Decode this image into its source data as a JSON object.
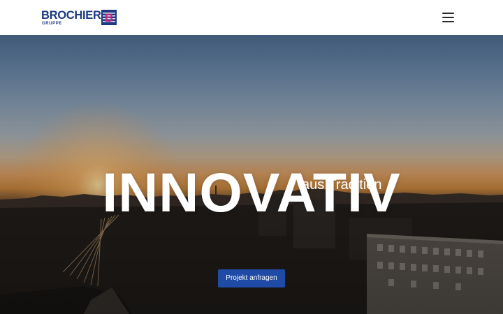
{
  "header": {
    "logo": {
      "wordmark": "BROCHIER",
      "subtitle": "GRUPPE",
      "mark_letter": "B"
    },
    "menu_icon": "hamburger-menu-icon"
  },
  "hero": {
    "headline": "INNOVATIV",
    "subline": "aus Tradition",
    "cta_label": "Projekt anfragen"
  },
  "colors": {
    "brand_blue": "#1b3a82",
    "brand_magenta": "#c6277f",
    "cta_background": "#1f4aa6",
    "header_background": "#ffffff",
    "headline_text": "#ffffff"
  }
}
